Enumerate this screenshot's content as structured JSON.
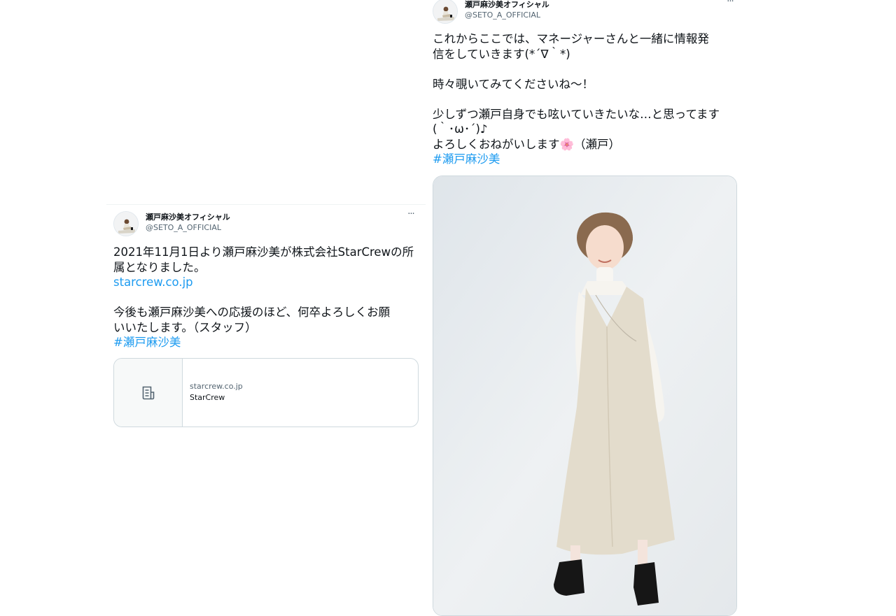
{
  "tweets": [
    {
      "display_name": "瀬戸麻沙美オフィシャル",
      "handle": "@SETO_A_OFFICIAL",
      "more_label": "···",
      "text_lines": [
        "2021年11月1日より瀬戸麻沙美が株式会社StarCrewの所",
        "属となりました。"
      ],
      "link": "starcrew.co.jp",
      "text_lines_2": [
        "今後も瀬戸麻沙美への応援のほど、何卒よろしくお願",
        "いいたします。（スタッフ）"
      ],
      "hashtag": "#瀬戸麻沙美",
      "card": {
        "icon": "article-icon",
        "domain": "starcrew.co.jp",
        "title": "StarCrew"
      }
    },
    {
      "display_name": "瀬戸麻沙美オフィシャル",
      "handle": "@SETO_A_OFFICIAL",
      "more_label": "···",
      "text_lines": [
        "これからここでは、マネージャーさんと一緒に情報発",
        "信をしていきます(*´∇｀*)"
      ],
      "text_lines_2": [
        "時々覗いてみてくださいね〜！"
      ],
      "text_lines_3": [
        "少しずつ瀬戸自身でも呟いていきたいな…と思ってます",
        "(｀･ω･´)♪",
        "よろしくおねがいします🌸（瀬戸）"
      ],
      "hashtag": "#瀬戸麻沙美",
      "photo": "photo-of-woman-in-beige-dress"
    }
  ],
  "colors": {
    "link": "#1d9bf0",
    "text": "#0f1419",
    "secondary": "#536471",
    "border": "#cfd9de"
  }
}
